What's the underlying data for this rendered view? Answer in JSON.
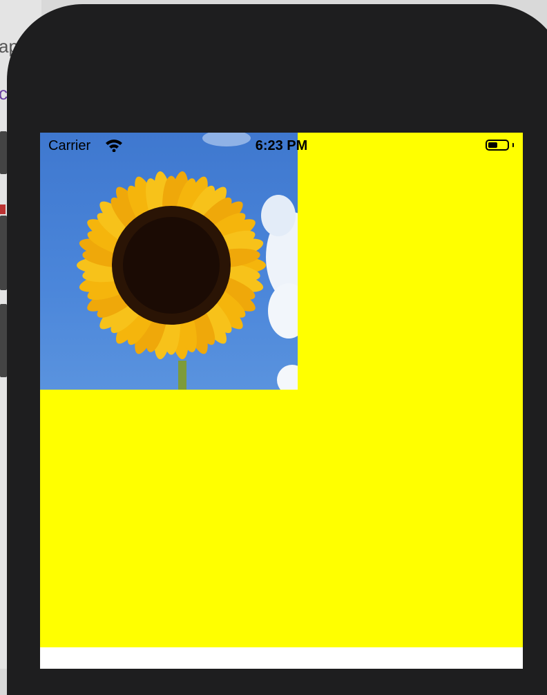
{
  "status_bar": {
    "carrier": "Carrier",
    "time": "6:23 PM",
    "battery_level": 0.5
  },
  "screen": {
    "background_color": "#ffff00",
    "image": {
      "subject": "sunflower against blue sky"
    }
  },
  "background_app": {
    "fragment_1": "ap",
    "fragment_2": "c"
  },
  "icons": [
    "wifi-icon",
    "battery-icon"
  ]
}
